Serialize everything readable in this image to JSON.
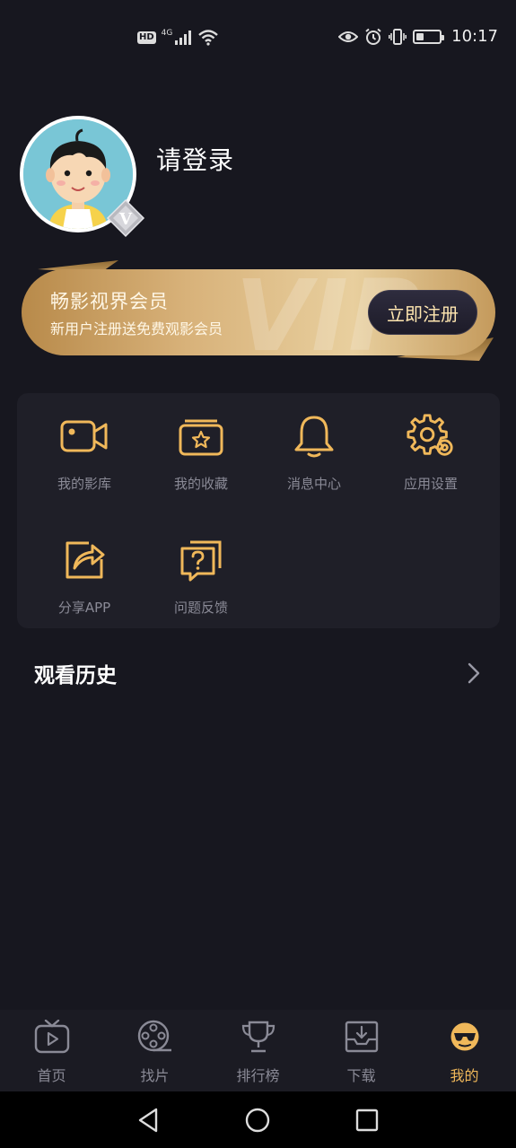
{
  "status_bar": {
    "hd_label": "HD",
    "network_label": "4G",
    "time": "10:17",
    "battery_level": 0.35,
    "icons": [
      "signal-icon",
      "wifi-icon",
      "eye-icon",
      "alarm-icon",
      "vibrate-icon",
      "battery-icon"
    ]
  },
  "profile": {
    "login_prompt": "请登录",
    "badge_letter": "V"
  },
  "vip_banner": {
    "title": "畅影视界会员",
    "subtitle": "新用户注册送免费观影会员",
    "button_label": "立即注册",
    "watermark": "VIP"
  },
  "features": [
    {
      "label": "我的影库",
      "icon": "video-camera-icon"
    },
    {
      "label": "我的收藏",
      "icon": "star-folder-icon"
    },
    {
      "label": "消息中心",
      "icon": "bell-icon"
    },
    {
      "label": "应用设置",
      "icon": "gear-icon"
    },
    {
      "label": "分享APP",
      "icon": "share-icon"
    },
    {
      "label": "问题反馈",
      "icon": "question-icon"
    }
  ],
  "history": {
    "title": "观看历史"
  },
  "bottom_nav": [
    {
      "label": "首页",
      "icon": "tv-icon",
      "active": false
    },
    {
      "label": "找片",
      "icon": "film-reel-icon",
      "active": false
    },
    {
      "label": "排行榜",
      "icon": "trophy-icon",
      "active": false
    },
    {
      "label": "下载",
      "icon": "download-icon",
      "active": false
    },
    {
      "label": "我的",
      "icon": "sunglasses-face-icon",
      "active": true
    }
  ],
  "colors": {
    "background": "#17171f",
    "card": "#1f1f28",
    "accent_gold": "#f0b85a",
    "muted_text": "#8a8a96"
  }
}
